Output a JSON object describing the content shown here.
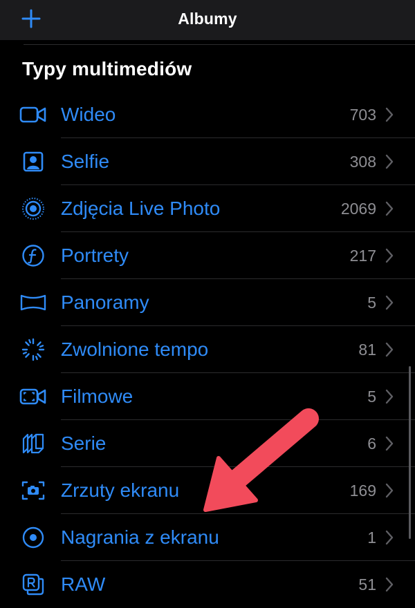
{
  "navbar": {
    "title": "Albumy",
    "add_icon": "plus-icon"
  },
  "section": {
    "title": "Typy multimediów"
  },
  "accent_color": "#2f8bf7",
  "arrow_color": "#f24b5b",
  "items": [
    {
      "label": "Wideo",
      "count": "703",
      "icon": "video-icon"
    },
    {
      "label": "Selfie",
      "count": "308",
      "icon": "selfie-icon"
    },
    {
      "label": "Zdjęcia Live Photo",
      "count": "2069",
      "icon": "live-photo-icon"
    },
    {
      "label": "Portrety",
      "count": "217",
      "icon": "portrait-icon"
    },
    {
      "label": "Panoramy",
      "count": "5",
      "icon": "panorama-icon"
    },
    {
      "label": "Zwolnione tempo",
      "count": "81",
      "icon": "slow-motion-icon"
    },
    {
      "label": "Filmowe",
      "count": "5",
      "icon": "cinematic-icon"
    },
    {
      "label": "Serie",
      "count": "6",
      "icon": "burst-icon"
    },
    {
      "label": "Zrzuty ekranu",
      "count": "169",
      "icon": "screenshot-icon"
    },
    {
      "label": "Nagrania z ekranu",
      "count": "1",
      "icon": "screen-recording-icon"
    },
    {
      "label": "RAW",
      "count": "51",
      "icon": "raw-icon"
    }
  ]
}
